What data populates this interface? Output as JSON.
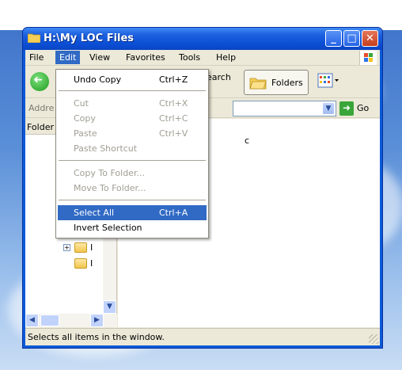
{
  "window": {
    "title": "H:\\My LOC Files"
  },
  "titlebar_buttons": [
    "_",
    "□",
    "✕"
  ],
  "menubar": [
    "File",
    "Edit",
    "View",
    "Favorites",
    "Tools",
    "Help"
  ],
  "toolbar": {
    "search_label": "Search",
    "folders_label": "Folders"
  },
  "addressbar": {
    "label": "Addre",
    "go_label": "Go"
  },
  "leftpane": {
    "header": "Folder",
    "tree_rows": [
      "I",
      "I",
      "I",
      "I"
    ]
  },
  "rightpane": {
    "text_1": "c"
  },
  "statusbar": {
    "text": "Selects all items in the window."
  },
  "edit_menu": {
    "items": [
      {
        "label": "Undo Copy",
        "shortcut": "Ctrl+Z",
        "state": "enabled"
      },
      {
        "label": "Cut",
        "shortcut": "Ctrl+X",
        "state": "disabled"
      },
      {
        "label": "Copy",
        "shortcut": "Ctrl+C",
        "state": "disabled"
      },
      {
        "label": "Paste",
        "shortcut": "Ctrl+V",
        "state": "disabled"
      },
      {
        "label": "Paste Shortcut",
        "shortcut": "",
        "state": "disabled"
      },
      {
        "label": "Copy To Folder...",
        "shortcut": "",
        "state": "disabled"
      },
      {
        "label": "Move To Folder...",
        "shortcut": "",
        "state": "disabled"
      },
      {
        "label": "Select All",
        "shortcut": "Ctrl+A",
        "state": "highlighted"
      },
      {
        "label": "Invert Selection",
        "shortcut": "",
        "state": "enabled"
      }
    ]
  },
  "colors": {
    "highlight": "#316ac5",
    "titlebar": "#0b4fd6",
    "chrome": "#ece9d8"
  }
}
